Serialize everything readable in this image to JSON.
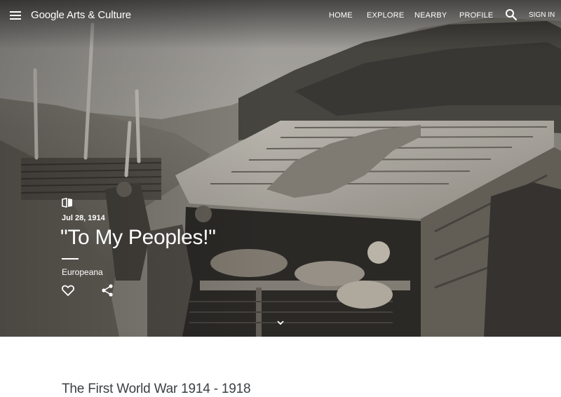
{
  "colors": {
    "hero_text": "#ffffff",
    "body_text": "#3c4043",
    "photo_sky": "#bdbab4",
    "photo_earth": "#6a665f",
    "photo_dark": "#2e2c29"
  },
  "hero": {
    "image_subject": "black and white photograph of soldiers resting in a trench dugout with wooden plank roof"
  },
  "header": {
    "menu_icon": "hamburger-menu-icon",
    "brand": "Google Arts & Culture",
    "nav": [
      {
        "label": "HOME"
      },
      {
        "label": "EXPLORE"
      },
      {
        "label": "NEARBY"
      },
      {
        "label": "PROFILE"
      }
    ],
    "search_icon": "search-icon",
    "signin_label": "SIGN IN"
  },
  "story": {
    "type_icon": "open-book-icon",
    "date": "Jul 28, 1914",
    "title": "\"To My Peoples!\"",
    "source": "Europeana",
    "favorite_icon": "heart-outline-icon",
    "share_icon": "share-icon",
    "scroll_icon": "chevron-down-icon"
  },
  "section": {
    "title": "The First World War 1914 - 1918"
  }
}
